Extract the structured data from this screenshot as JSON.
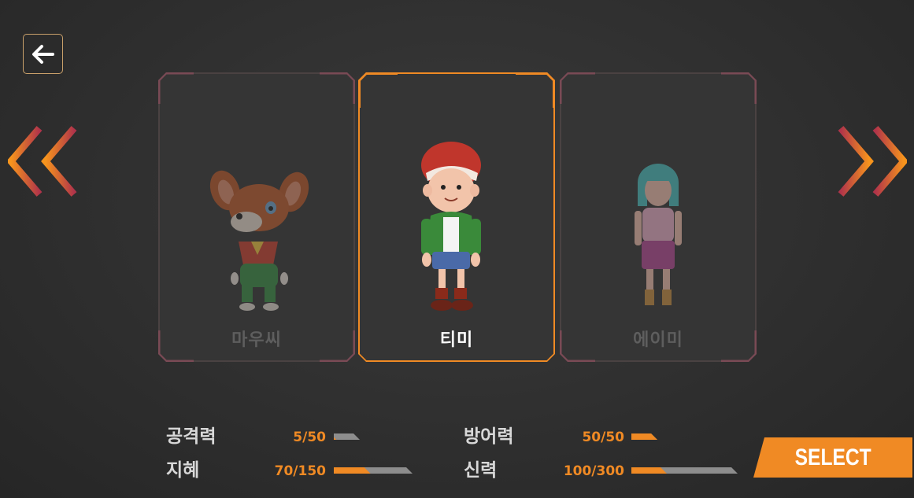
{
  "carousel": {
    "characters": [
      {
        "name": "마우씨",
        "selected": false
      },
      {
        "name": "티미",
        "selected": true
      },
      {
        "name": "에이미",
        "selected": false
      }
    ]
  },
  "stats": {
    "attack": {
      "label": "공격력",
      "value": "5/50",
      "fraction": 0.1
    },
    "defense": {
      "label": "방어력",
      "value": "50/50",
      "fraction": 1.0
    },
    "wisdom": {
      "label": "지혜",
      "value": "70/150",
      "fraction": 0.4667
    },
    "faith": {
      "label": "신력",
      "value": "100/300",
      "fraction": 0.3333
    }
  },
  "select_button": {
    "label": "SELECT"
  },
  "colors": {
    "accent": "#f08a24",
    "bar_track": "#8d8d8d",
    "background": "#2f2f2f"
  },
  "icons": {
    "back": "arrow-left-icon",
    "prev": "double-chevron-left-icon",
    "next": "double-chevron-right-icon"
  }
}
